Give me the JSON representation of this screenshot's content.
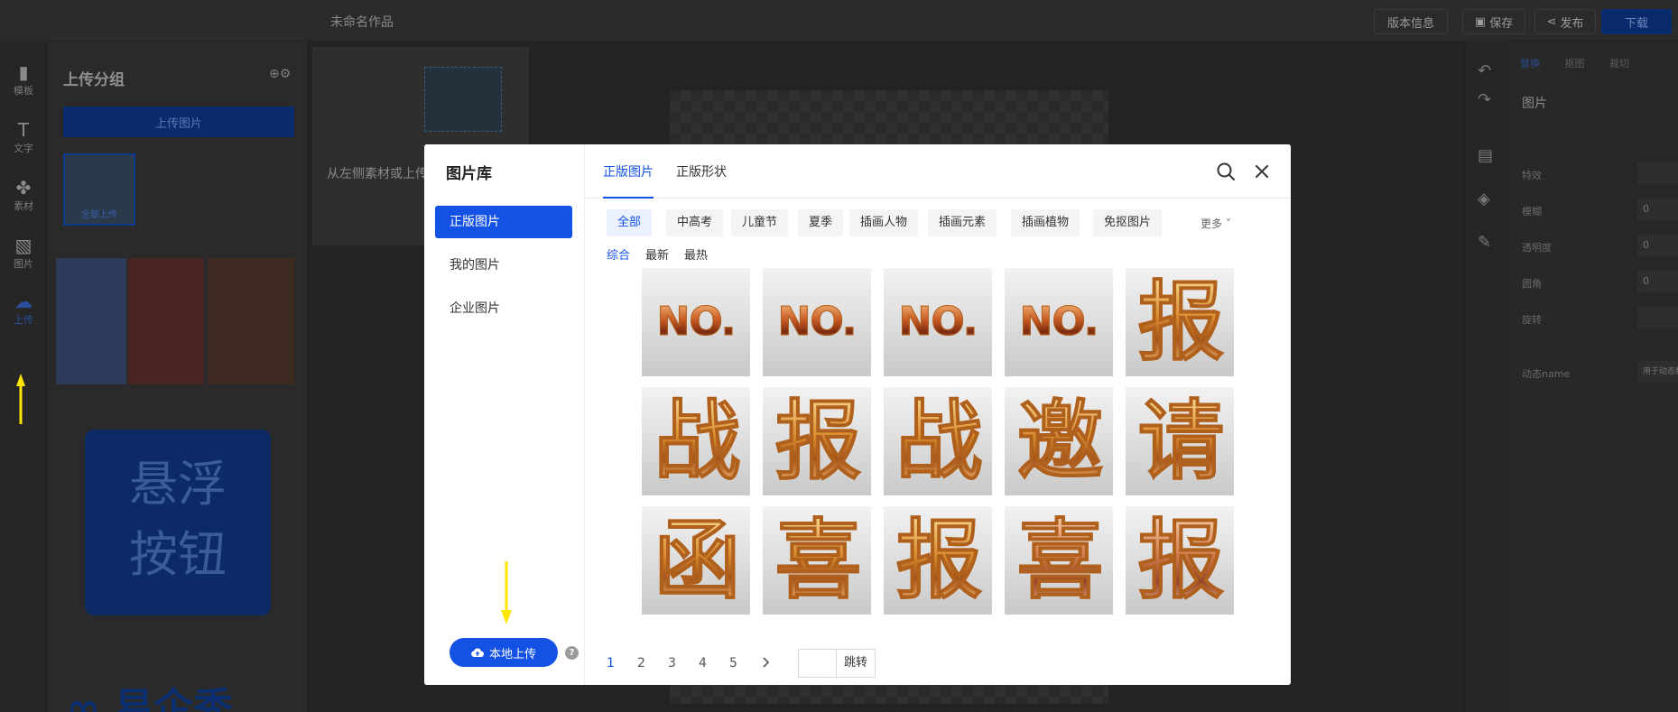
{
  "editor": {
    "doc_title": "未命名作品",
    "top_actions": {
      "version": "版本信息",
      "save": "保存",
      "publish": "发布",
      "download": "下载"
    },
    "left_nav": [
      {
        "label": "模板",
        "icon": "template-icon"
      },
      {
        "label": "文字",
        "icon": "text-icon"
      },
      {
        "label": "素材",
        "icon": "material-icon"
      },
      {
        "label": "图片",
        "icon": "image-icon"
      },
      {
        "label": "上传",
        "icon": "upload-icon"
      }
    ],
    "panel": {
      "title": "上传分组",
      "upload_button": "上传图片",
      "thumb_label": "全部上传",
      "float_button_line1": "悬浮",
      "float_button_line2": "按钮",
      "brand_text": "易企秀"
    },
    "layer_hint": "从左侧素材或上传进行替换",
    "props": {
      "tabs": [
        "替换",
        "抠图",
        "裁切"
      ],
      "title": "图片",
      "rows": [
        {
          "label": "特效",
          "value": ""
        },
        {
          "label": "模糊",
          "value": "0"
        },
        {
          "label": "透明度",
          "value": "0"
        },
        {
          "label": "圆角",
          "value": "0"
        },
        {
          "label": "旋转",
          "value": ""
        },
        {
          "label": "动态name",
          "value": "用于动态数据"
        }
      ]
    }
  },
  "modal": {
    "title": "图片库",
    "side_items": [
      "正版图片",
      "我的图片",
      "企业图片"
    ],
    "local_upload": "本地上传",
    "help": "?",
    "tabs": [
      "正版图片",
      "正版形状"
    ],
    "chips": [
      "全部",
      "中高考",
      "儿童节",
      "夏季",
      "插画人物",
      "插画元素",
      "插画植物",
      "免抠图片"
    ],
    "more": "更多 ˅",
    "sorts": [
      "综合",
      "最新",
      "最热"
    ],
    "tiles": [
      "NO.",
      "NO.",
      "NO.",
      "NO.",
      "报",
      "战",
      "报",
      "战",
      "邀",
      "请",
      "函",
      "喜",
      "报",
      "喜",
      "报"
    ],
    "pager": {
      "pages": [
        "1",
        "2",
        "3",
        "4",
        "5"
      ],
      "current": "1",
      "jump": "跳转"
    }
  },
  "colors": {
    "primary": "#1452e6",
    "annotation_arrow": "#ffe600"
  }
}
